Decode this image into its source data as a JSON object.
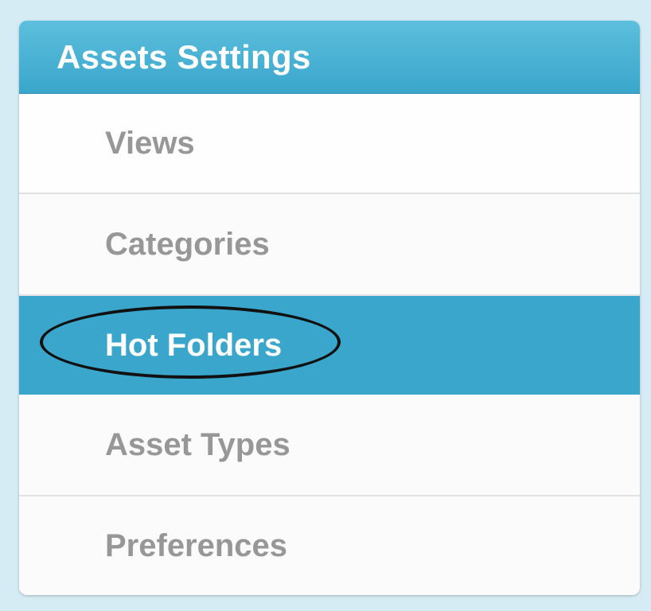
{
  "panel": {
    "title": "Assets Settings",
    "items": [
      {
        "label": "Views"
      },
      {
        "label": "Categories"
      },
      {
        "label": "Hot Folders",
        "selected": true
      },
      {
        "label": "Asset Types"
      },
      {
        "label": "Preferences"
      }
    ]
  },
  "colors": {
    "page_background": "#d6ecf4",
    "header": "#3aa6cb",
    "selected_item": "#3ba6cc",
    "item_text": "#979797",
    "annotation_ellipse": "#111111"
  }
}
